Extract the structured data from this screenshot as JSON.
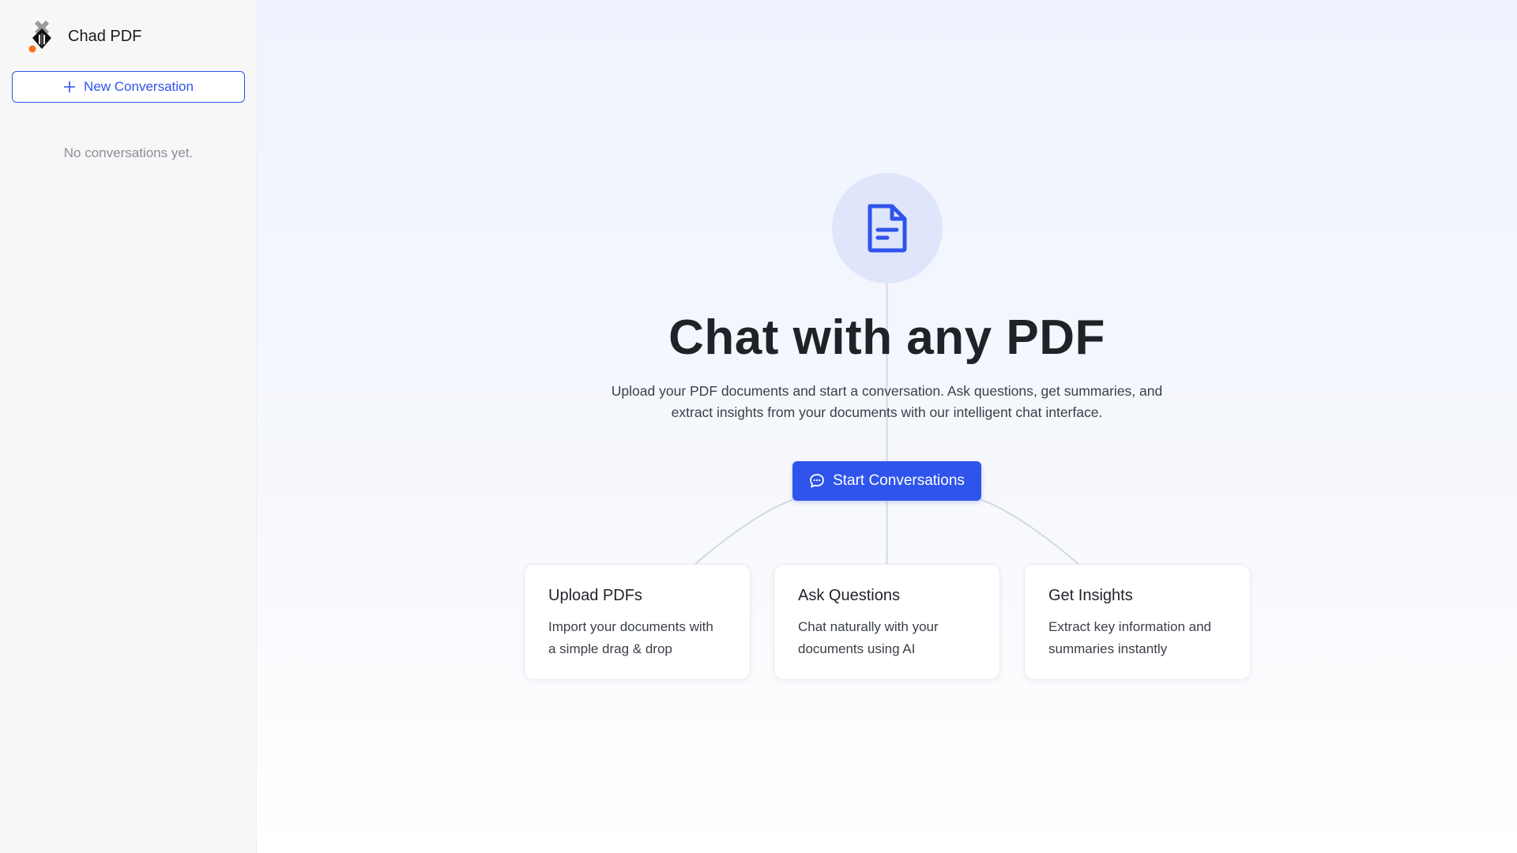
{
  "app": {
    "title": "Chad PDF"
  },
  "sidebar": {
    "new_conversation_label": "New Conversation",
    "empty_text": "No conversations yet."
  },
  "hero": {
    "icon": "file-text-icon",
    "title": "Chat with any PDF",
    "subtitle_line1": "Upload your PDF documents and start a conversation. Ask questions, get summaries, and",
    "subtitle_line2": "extract insights from your documents with our intelligent chat interface.",
    "cta_label": "Start Conversations",
    "cta_icon": "chat-bubble-icon"
  },
  "features": [
    {
      "title": "Upload PDFs",
      "line1": "Import your documents with",
      "line2": "a simple drag & drop"
    },
    {
      "title": "Ask Questions",
      "line1": "Chat naturally with your",
      "line2": "documents using AI"
    },
    {
      "title": "Get Insights",
      "line1": "Extract key information and",
      "line2": "summaries instantly"
    }
  ],
  "colors": {
    "accent": "#2f54eb",
    "sidebar_bg": "#f7f7f8",
    "icon_circle_bg": "#dfe6fb",
    "logo_dot": "#f97316"
  }
}
